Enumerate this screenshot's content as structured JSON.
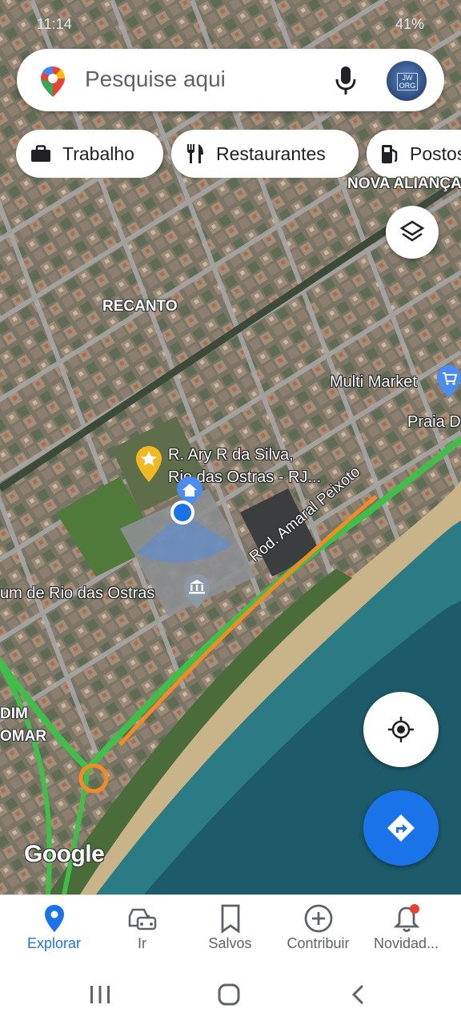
{
  "status_bar": {
    "time": "11:14",
    "battery": "41%"
  },
  "search": {
    "placeholder": "Pesquise aqui"
  },
  "chips": [
    {
      "label": "Trabalho",
      "icon": "briefcase-icon"
    },
    {
      "label": "Restaurantes",
      "icon": "fork-knife-icon"
    },
    {
      "label": "Postos",
      "icon": "gas-station-icon"
    }
  ],
  "map": {
    "neighborhoods": {
      "nova_alianca": "NOVA ALIANÇA",
      "recanto": "RECANTO",
      "jardim": "DIM",
      "mar": "OMAR"
    },
    "pois": {
      "market": "Multi Market",
      "praia": "Praia D",
      "saved_place_line1": "R. Ary R da Silva,",
      "saved_place_line2": "Rio das Ostras - RJ...",
      "museum": "um de Rio das Ostras",
      "road": "Rod. Amaral Peixoto"
    },
    "attribution": "Google",
    "colors": {
      "accent": "#1a73e8",
      "traffic_green": "#3fbf4a",
      "traffic_orange": "#f28b22",
      "sea": "#1f5e6e",
      "star": "#f2b81f"
    }
  },
  "bottom_nav": [
    {
      "label": "Explorar",
      "icon": "explore-pin-icon",
      "active": true
    },
    {
      "label": "Ir",
      "icon": "car-icon",
      "active": false
    },
    {
      "label": "Salvos",
      "icon": "bookmark-icon",
      "active": false
    },
    {
      "label": "Contribuir",
      "icon": "add-circle-icon",
      "active": false
    },
    {
      "label": "Novidad...",
      "icon": "bell-icon",
      "active": false
    }
  ]
}
